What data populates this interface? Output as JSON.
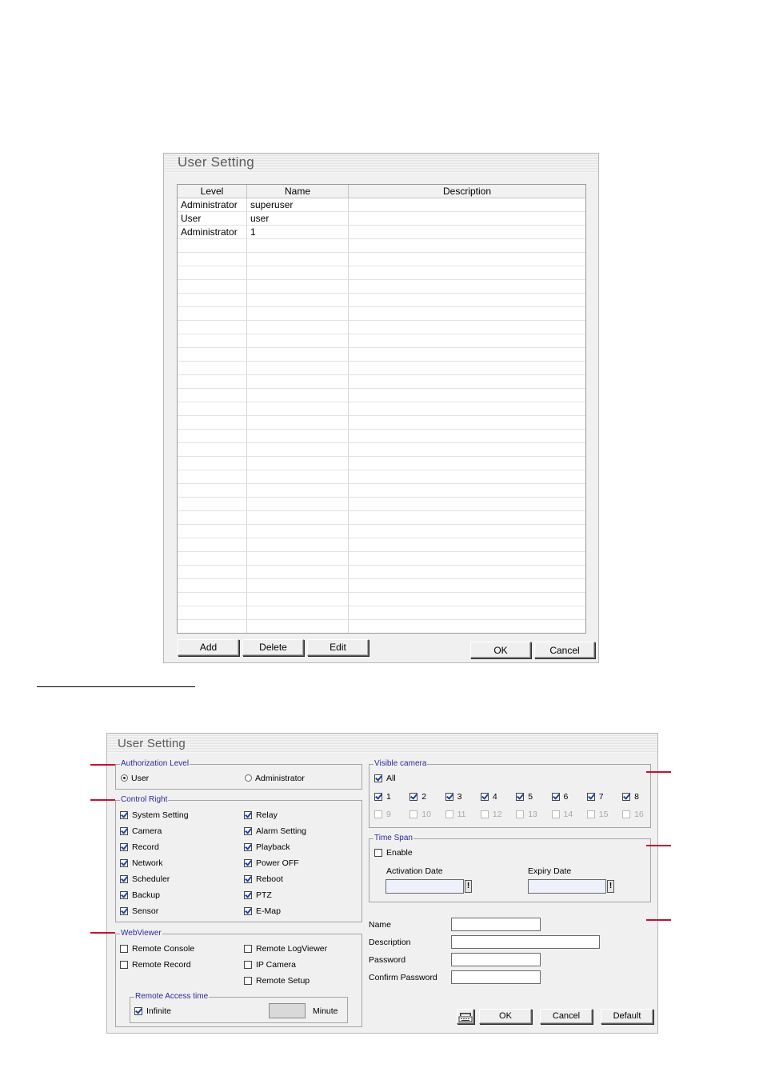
{
  "window1": {
    "title": "User Setting",
    "columns": [
      "Level",
      "Name",
      "Description"
    ],
    "rows": [
      [
        "Administrator",
        "superuser",
        ""
      ],
      [
        "User",
        "user",
        ""
      ],
      [
        "Administrator",
        "1",
        ""
      ]
    ],
    "buttons": {
      "add": "Add",
      "delete": "Delete",
      "edit": "Edit",
      "ok": "OK",
      "cancel": "Cancel"
    }
  },
  "window2": {
    "title": "User Setting",
    "authorization": {
      "label": "Authorization Level",
      "options": [
        "User",
        "Administrator"
      ],
      "selected": "User"
    },
    "control_right": {
      "label": "Control Right",
      "left": [
        {
          "label": "System Setting",
          "checked": true
        },
        {
          "label": "Camera",
          "checked": true
        },
        {
          "label": "Record",
          "checked": true
        },
        {
          "label": "Network",
          "checked": true
        },
        {
          "label": "Scheduler",
          "checked": true
        },
        {
          "label": "Backup",
          "checked": true
        },
        {
          "label": "Sensor",
          "checked": true
        }
      ],
      "right": [
        {
          "label": "Relay",
          "checked": true
        },
        {
          "label": "Alarm Setting",
          "checked": true
        },
        {
          "label": "Playback",
          "checked": true
        },
        {
          "label": "Power OFF",
          "checked": true
        },
        {
          "label": "Reboot",
          "checked": true
        },
        {
          "label": "PTZ",
          "checked": true
        },
        {
          "label": "E-Map",
          "checked": true
        }
      ]
    },
    "webviewer": {
      "label": "WebViewer",
      "items": [
        {
          "label": "Remote Console",
          "checked": false
        },
        {
          "label": "Remote LogViewer",
          "checked": false
        },
        {
          "label": "Remote Record",
          "checked": false
        },
        {
          "label": "IP Camera",
          "checked": false
        },
        {
          "label": "Remote Setup",
          "checked": false
        }
      ],
      "remote_access": {
        "label": "Remote Access time",
        "infinite_label": "Infinite",
        "infinite_checked": true,
        "minute_label": "Minute"
      }
    },
    "visible_camera": {
      "label": "Visible camera",
      "all_label": "All",
      "all_checked": true,
      "cameras": [
        {
          "label": "1",
          "checked": true,
          "enabled": true
        },
        {
          "label": "2",
          "checked": true,
          "enabled": true
        },
        {
          "label": "3",
          "checked": true,
          "enabled": true
        },
        {
          "label": "4",
          "checked": true,
          "enabled": true
        },
        {
          "label": "5",
          "checked": true,
          "enabled": true
        },
        {
          "label": "6",
          "checked": true,
          "enabled": true
        },
        {
          "label": "7",
          "checked": true,
          "enabled": true
        },
        {
          "label": "8",
          "checked": true,
          "enabled": true
        },
        {
          "label": "9",
          "checked": false,
          "enabled": false
        },
        {
          "label": "10",
          "checked": false,
          "enabled": false
        },
        {
          "label": "11",
          "checked": false,
          "enabled": false
        },
        {
          "label": "12",
          "checked": false,
          "enabled": false
        },
        {
          "label": "13",
          "checked": false,
          "enabled": false
        },
        {
          "label": "14",
          "checked": false,
          "enabled": false
        },
        {
          "label": "15",
          "checked": false,
          "enabled": false
        },
        {
          "label": "16",
          "checked": false,
          "enabled": false
        }
      ]
    },
    "time_span": {
      "label": "Time Span",
      "enable_label": "Enable",
      "enable_checked": false,
      "activation_label": "Activation Date",
      "expiry_label": "Expiry Date",
      "picker_glyph": "!"
    },
    "fields": {
      "name_label": "Name",
      "description_label": "Description",
      "password_label": "Password",
      "confirm_label": "Confirm Password"
    },
    "buttons": {
      "ok": "OK",
      "cancel": "Cancel",
      "default": "Default"
    }
  },
  "colors": {
    "annotation_red": "#c8102e",
    "group_label_blue": "#2a2a9a",
    "checkmark_blue": "#1e3ea8"
  }
}
